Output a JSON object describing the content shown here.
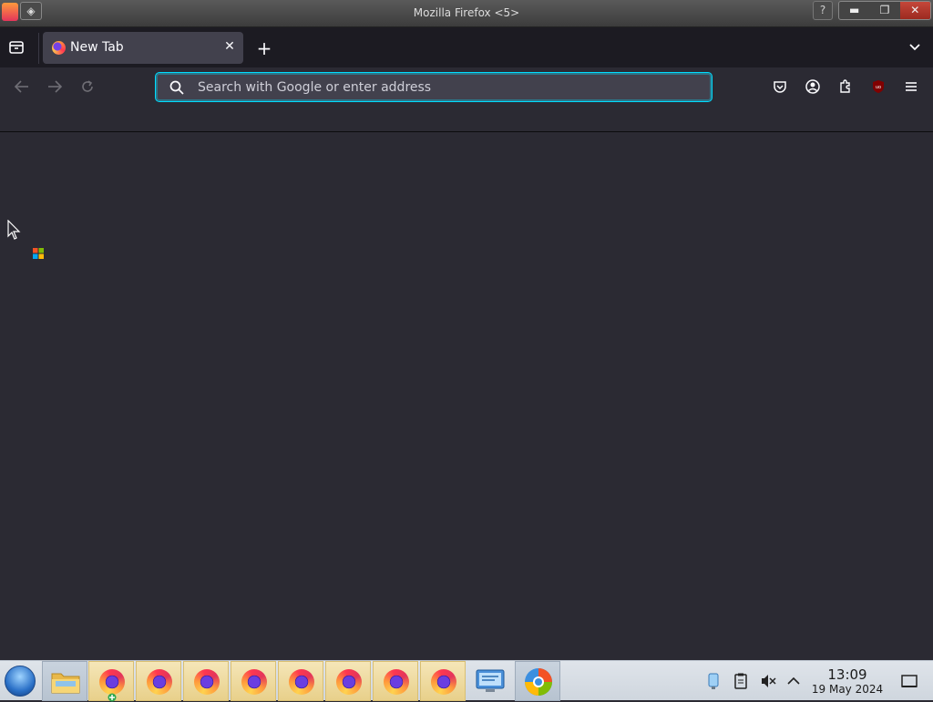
{
  "window": {
    "title": "Mozilla Firefox <5>",
    "help_label": "?",
    "minimize_label": "▬",
    "maximize_label": "❐",
    "close_label": "✕"
  },
  "tabs": [
    {
      "label": "New Tab",
      "active": true
    }
  ],
  "tabstrip": {
    "new_tab_label": "+",
    "close_tab_label": "✕"
  },
  "urlbar": {
    "placeholder": "Search with Google or enter address",
    "value": ""
  },
  "toolbar_icons": [
    "back-icon",
    "forward-icon",
    "reload-icon",
    "pocket-icon",
    "account-icon",
    "extensions-icon",
    "ublock-icon",
    "menu-icon"
  ],
  "taskbar": {
    "pinned": [
      "start-orb",
      "file-manager-icon",
      "firefox-icon",
      "firefox-icon",
      "firefox-icon",
      "firefox-icon",
      "firefox-icon",
      "firefox-icon",
      "firefox-icon",
      "firefox-icon",
      "control-panel-icon",
      "chrome-like-icon"
    ],
    "clock_time": "13:09",
    "clock_date": "19 May 2024"
  },
  "colors": {
    "toolbar_bg": "#2b2a33",
    "tabstrip_bg": "#1c1b22",
    "tab_active_bg": "#42414d",
    "urlbar_focus": "#00ddff"
  }
}
